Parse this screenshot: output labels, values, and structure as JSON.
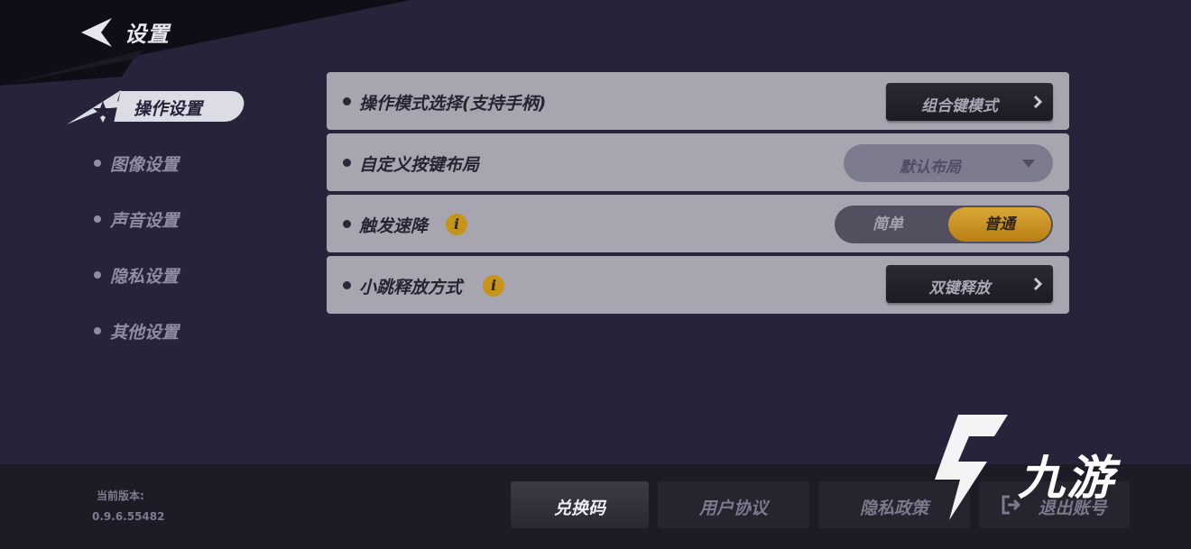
{
  "header": {
    "title": "设置",
    "back_icon": "back-arrow-icon"
  },
  "sidebar": {
    "active": {
      "label": "操作设置",
      "icon": "star-icon"
    },
    "items": [
      {
        "label": "图像设置"
      },
      {
        "label": "声音设置"
      },
      {
        "label": "隐私设置"
      },
      {
        "label": "其他设置"
      }
    ]
  },
  "settings": {
    "control_mode": {
      "label": "操作模式选择(支持手柄)",
      "value": "组合键模式"
    },
    "custom_layout": {
      "label": "自定义按键布局",
      "value": "默认布局"
    },
    "trigger_speed": {
      "label": "触发速降",
      "options": [
        "简单",
        "普通"
      ],
      "selected": "普通"
    },
    "jump_release": {
      "label": "小跳释放方式",
      "value": "双键释放"
    }
  },
  "footer": {
    "version_label": "当前版本:",
    "version": "0.9.6.55482",
    "buttons": {
      "redeem": "兑换码",
      "user_agreement": "用户协议",
      "privacy_policy": "隐私政策",
      "logout": "退出账号"
    }
  },
  "watermark": {
    "text": "九游"
  },
  "colors": {
    "accent": "#c7941a",
    "background": "#26233a",
    "row": "#a7a6b0"
  }
}
